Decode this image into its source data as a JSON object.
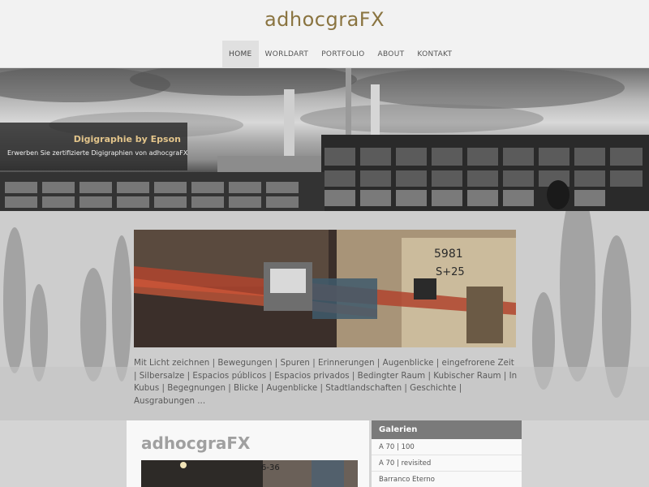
{
  "site": {
    "title": "adhocgraFX"
  },
  "nav": {
    "items": [
      {
        "label": "HOME",
        "active": true
      },
      {
        "label": "WORLDART",
        "active": false
      },
      {
        "label": "PORTFOLIO",
        "active": false
      },
      {
        "label": "ABOUT",
        "active": false
      },
      {
        "label": "KONTAKT",
        "active": false
      }
    ]
  },
  "banner": {
    "caption_title": "Digigraphie by Epson",
    "caption_text": "Erwerben Sie zertifizierte Digigraphien von adhocgraFX"
  },
  "intro": {
    "tags": "Mit Licht zeichnen | Bewegungen | Spuren | Erinnerungen | Augenblicke | eingefrorene Zeit | Silbersalze | Espacios públicos | Espacios privados | Bedingter Raum | Kubischer Raum | In Kubus | Begegnungen | Blicke | Augenblicke | Stadtlandschaften | Geschichte | Ausgrabungen ..."
  },
  "content": {
    "heading": "adhocgraFX"
  },
  "galleries": {
    "title": "Galerien",
    "items": [
      "A 70 | 100",
      "A 70 | revisited",
      "Barranco Eterno"
    ]
  },
  "colors": {
    "title": "#8a7440",
    "caption_title": "#e2c48a",
    "gallery_header": "#7a7a7a"
  }
}
